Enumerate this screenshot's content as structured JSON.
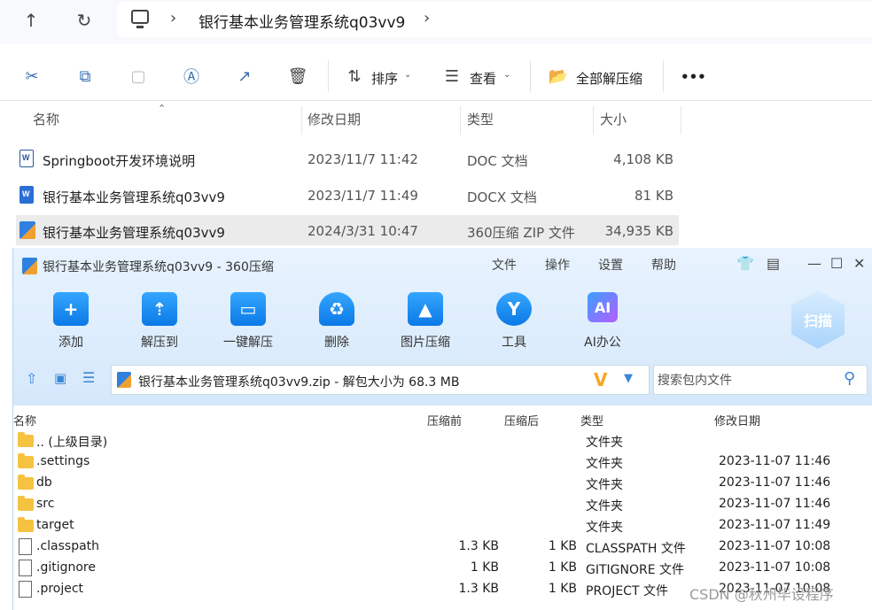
{
  "explorer": {
    "breadcrumb": "银行基本业务管理系统q03vv9",
    "toolbar": {
      "sort": "排序",
      "view": "查看",
      "extract_all": "全部解压缩",
      "more": "•••"
    },
    "columns": {
      "name": "名称",
      "modified": "修改日期",
      "type": "类型",
      "size": "大小"
    },
    "files": [
      {
        "name": "Springboot开发环境说明",
        "modified": "2023/11/7 11:42",
        "type": "DOC 文档",
        "size": "4,108 KB"
      },
      {
        "name": "银行基本业务管理系统q03vv9",
        "modified": "2023/11/7 11:49",
        "type": "DOCX 文档",
        "size": "81 KB"
      },
      {
        "name": "银行基本业务管理系统q03vv9",
        "modified": "2024/3/31 10:47",
        "type": "360压缩 ZIP 文件",
        "size": "34,935 KB"
      }
    ]
  },
  "zip": {
    "title": "银行基本业务管理系统q03vv9 - 360压缩",
    "menu": [
      "文件",
      "操作",
      "设置",
      "帮助"
    ],
    "tools": [
      {
        "label": "添加",
        "glyph": "+"
      },
      {
        "label": "解压到",
        "glyph": "⇡"
      },
      {
        "label": "一键解压",
        "glyph": "▭"
      },
      {
        "label": "删除",
        "glyph": "♻"
      },
      {
        "label": "图片压缩",
        "glyph": "▲"
      },
      {
        "label": "工具",
        "glyph": "Y"
      },
      {
        "label": "AI办公",
        "glyph": "AI"
      }
    ],
    "scan": "扫描",
    "path": "银行基本业务管理系统q03vv9.zip - 解包大小为 68.3 MB",
    "search_placeholder": "搜索包内文件",
    "columns": {
      "name": "名称",
      "before": "压缩前",
      "after": "压缩后",
      "type": "类型",
      "modified": "修改日期"
    },
    "rows": [
      {
        "name": ".. (上级目录)",
        "before": "",
        "after": "",
        "type": "文件夹",
        "modified": "",
        "icon": "folder"
      },
      {
        "name": ".settings",
        "before": "",
        "after": "",
        "type": "文件夹",
        "modified": "2023-11-07 11:46",
        "icon": "folder"
      },
      {
        "name": "db",
        "before": "",
        "after": "",
        "type": "文件夹",
        "modified": "2023-11-07 11:46",
        "icon": "folder"
      },
      {
        "name": "src",
        "before": "",
        "after": "",
        "type": "文件夹",
        "modified": "2023-11-07 11:46",
        "icon": "folder"
      },
      {
        "name": "target",
        "before": "",
        "after": "",
        "type": "文件夹",
        "modified": "2023-11-07 11:49",
        "icon": "folder"
      },
      {
        "name": ".classpath",
        "before": "1.3 KB",
        "after": "1 KB",
        "type": "CLASSPATH 文件",
        "modified": "2023-11-07 10:08",
        "icon": "file"
      },
      {
        "name": ".gitignore",
        "before": "1 KB",
        "after": "1 KB",
        "type": "GITIGNORE 文件",
        "modified": "2023-11-07 10:08",
        "icon": "file"
      },
      {
        "name": ".project",
        "before": "1.3 KB",
        "after": "1 KB",
        "type": "PROJECT 文件",
        "modified": "2023-11-07 10:08",
        "icon": "file"
      }
    ]
  },
  "watermark": "CSDN @秋州毕设程序"
}
